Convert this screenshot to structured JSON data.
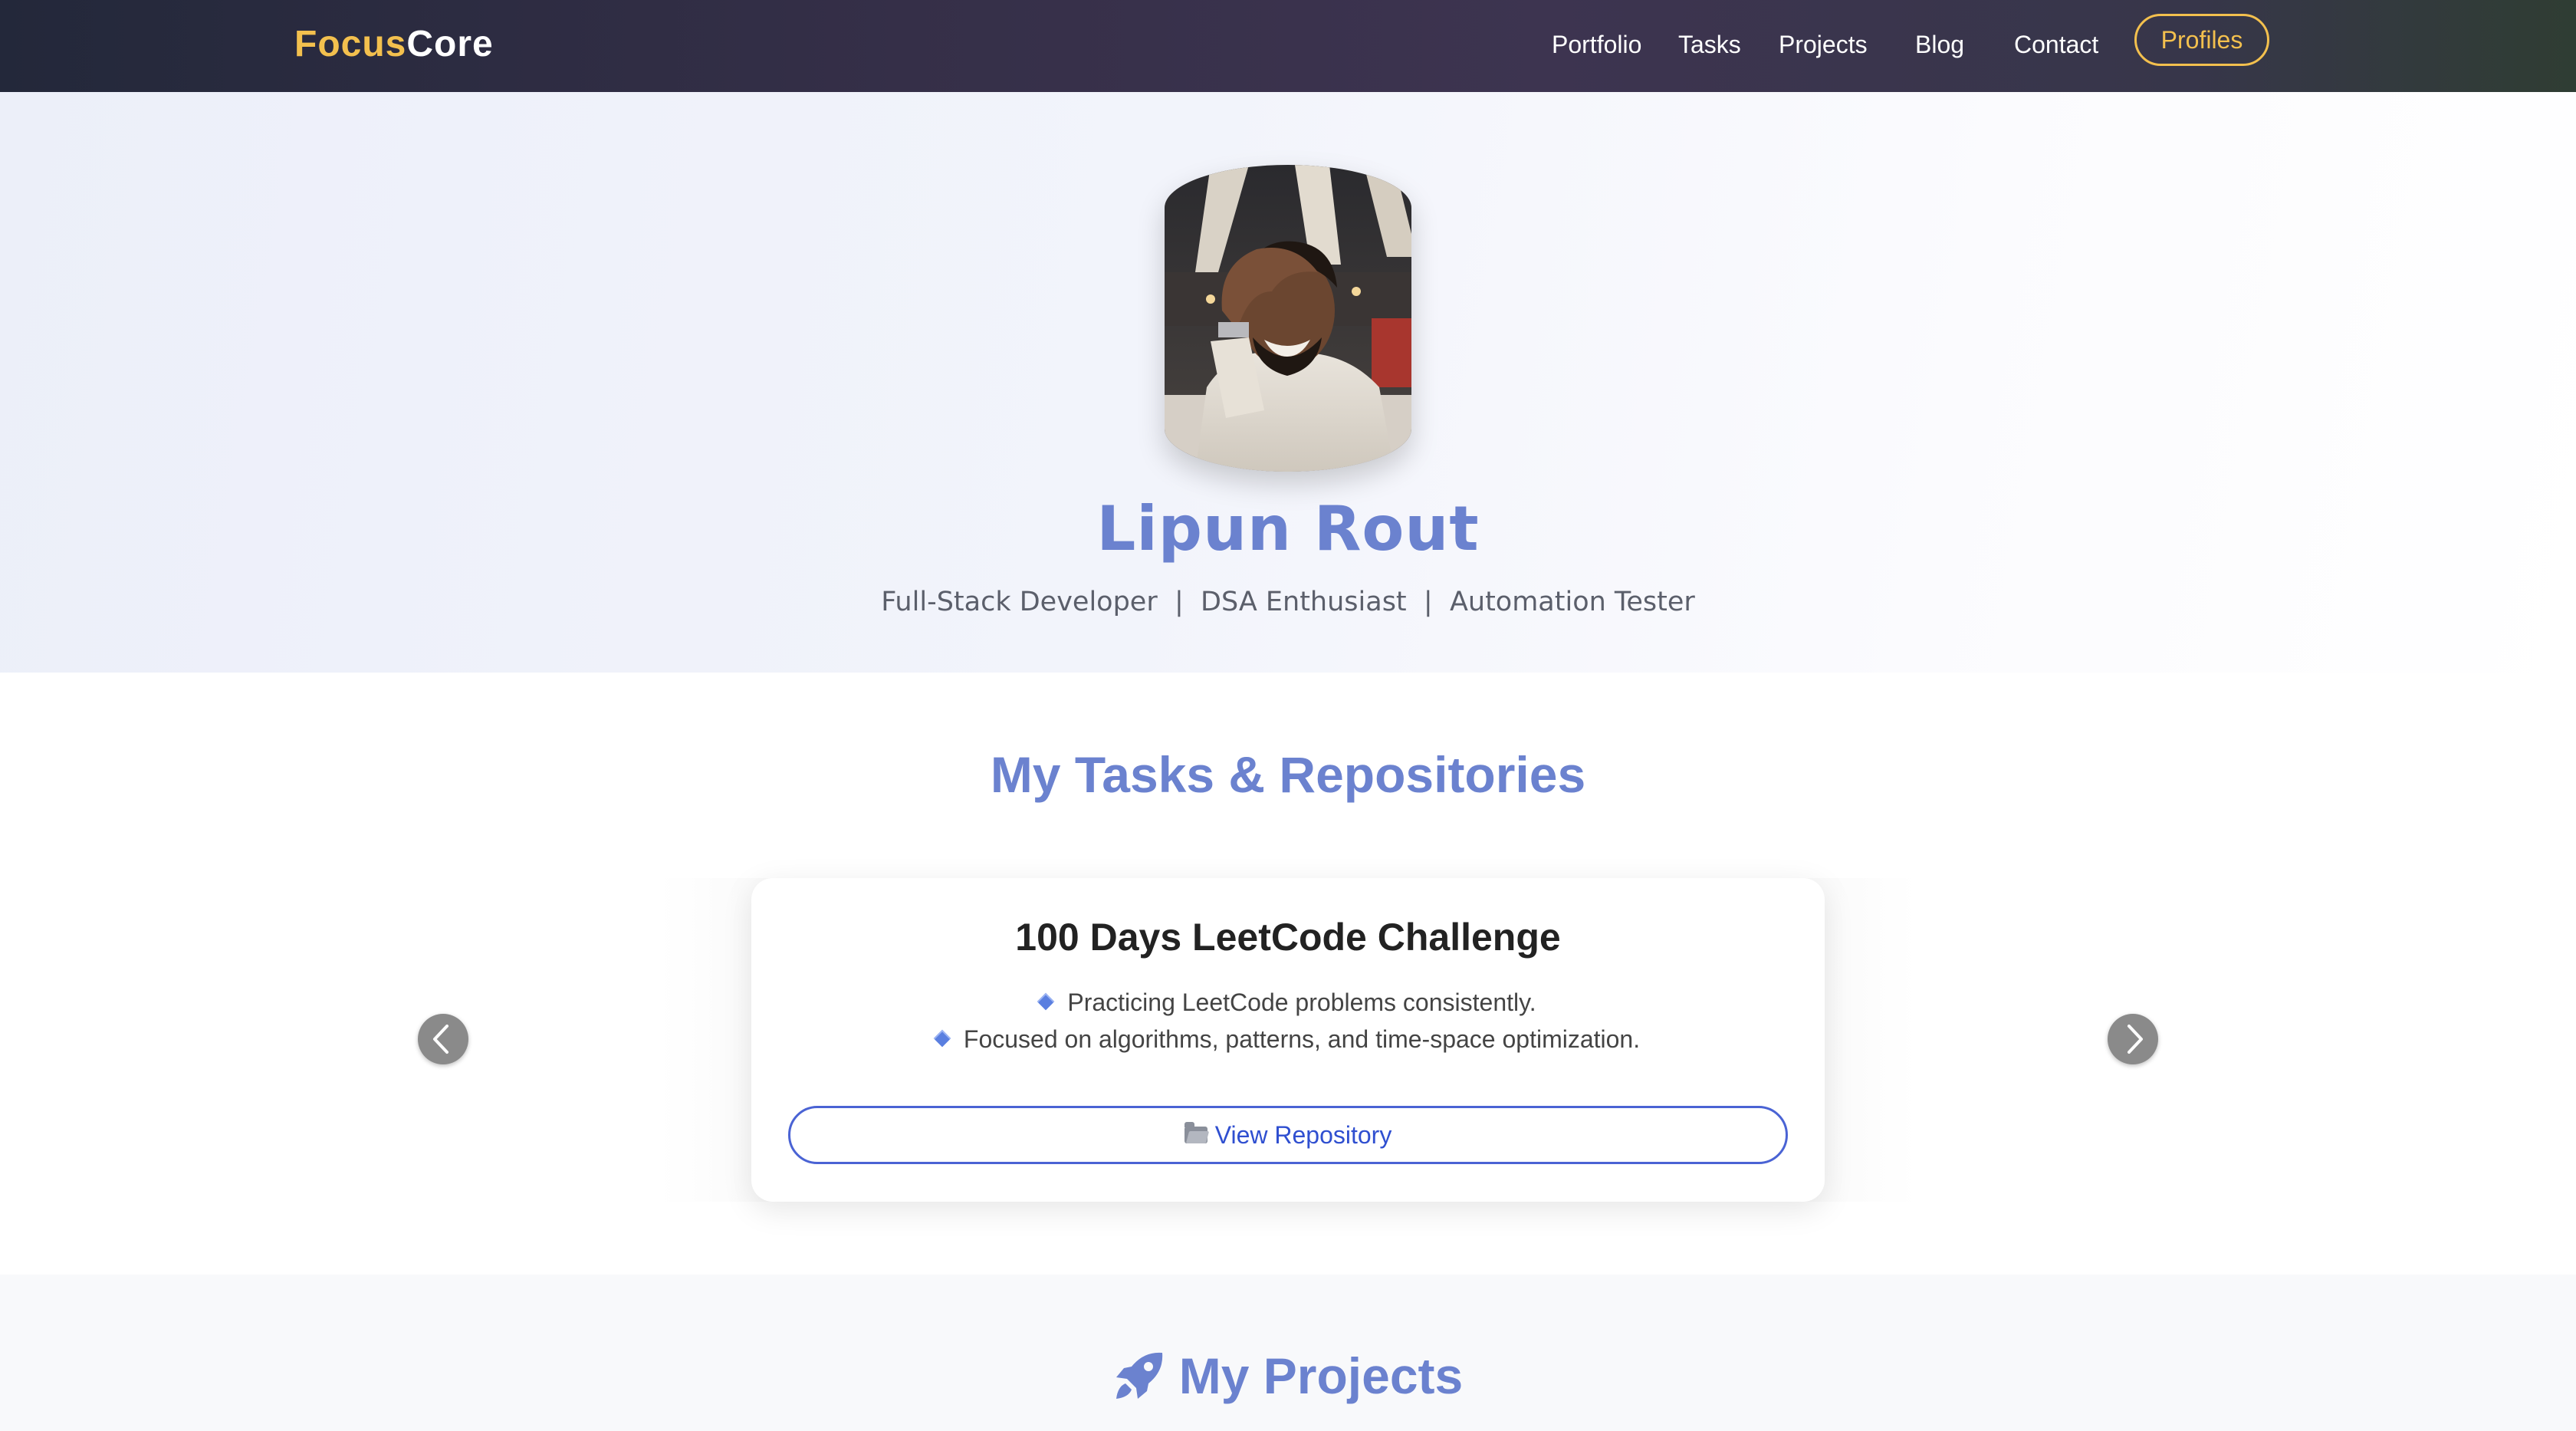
{
  "nav": {
    "brand_part1": "Focus",
    "brand_part2": "Core",
    "links": [
      "Portfolio",
      "Tasks",
      "Projects",
      "Blog",
      "Contact"
    ],
    "profiles_button": "Profiles"
  },
  "hero": {
    "name": "Lipun Rout",
    "subtitle": "Full-Stack Developer  |  DSA Enthusiast  |  Automation Tester"
  },
  "tasks": {
    "section_title": "My Tasks & Repositories",
    "card": {
      "title": "100 Days LeetCode Challenge",
      "points": [
        "Practicing LeetCode problems consistently.",
        "Focused on algorithms, patterns, and time-space optimization."
      ],
      "button_label": "View Repository"
    }
  },
  "projects": {
    "section_title": "My Projects"
  },
  "colors": {
    "accent": "#6b82cf",
    "brand_gold": "#f3c04e",
    "button_blue": "#4a63d4"
  },
  "icons": {
    "bullet": "diamond-icon",
    "repo": "folder-icon",
    "projects": "rocket-icon",
    "carousel_prev": "chevron-left-icon",
    "carousel_next": "chevron-right-icon"
  }
}
